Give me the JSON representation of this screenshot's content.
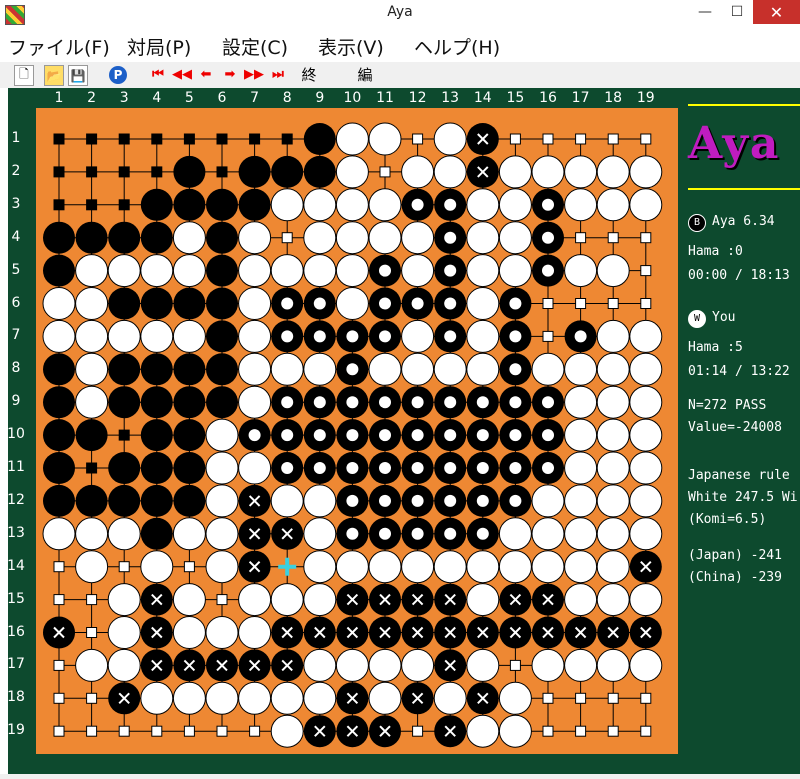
{
  "window": {
    "title": "Aya"
  },
  "window_controls": {
    "minimize": "—",
    "maximize": "☐",
    "close": "✕"
  },
  "menu": [
    "ファイル(F)",
    "対局(P)",
    "設定(C)",
    "表示(V)",
    "ヘルプ(H)"
  ],
  "toolbar": {
    "end_label": "終",
    "edit_label": "編",
    "pass_label": "P"
  },
  "board": {
    "size": 19,
    "col_labels": [
      "1",
      "2",
      "3",
      "4",
      "5",
      "6",
      "7",
      "8",
      "9",
      "10",
      "11",
      "12",
      "13",
      "14",
      "15",
      "16",
      "17",
      "18",
      "19"
    ],
    "row_labels": [
      "1",
      "2",
      "3",
      "4",
      "5",
      "6",
      "7",
      "8",
      "9",
      "10",
      "11",
      "12",
      "13",
      "14",
      "15",
      "16",
      "17",
      "18",
      "19"
    ],
    "grid": [
      "ssssssssBWWwWXwwwww",
      "ssssBsBBBWwWWXWWWWW",
      "sssBBBBWWWWRRWWRWWW",
      "BBBBWBWwWWWWRWWRwww",
      "BWWWWBWWWWRWRWWRWWw",
      "WWBBBBWRRWRRRWRwwww",
      "WWWWWBWRRRRWRWRwRWW",
      "BWBBBBWWWRWWWWRWWWW",
      "BWBBBBWRRRRRRRRRWWW",
      "BBsBBWRRRRRRRRRRWWW",
      "BsBBBWWRRRRRRRRRWWW",
      "BBBBBWXWWRRRRRRWWWW",
      "WWWBWWXXWRRRRRWWWWW",
      "sWsWwWXCWWWWWWWWWWX",
      "swWXWwWWWXXXXWXXWWW",
      "XwWXWWWXXXXXXXXXXXX",
      "sWWXXXXXWWWWXWwWWWW",
      "swXWWWWWWXWXWXWwwww",
      "sssssswWXXXsXWWssss"
    ]
  },
  "black_player": {
    "badge": "B",
    "name": "Aya 6.34",
    "hama": "Hama :0",
    "time": "00:00 / 18:13"
  },
  "white_player": {
    "badge": "W",
    "name": "You",
    "hama": "Hama :5",
    "time": "01:14 / 13:22"
  },
  "status": {
    "moves": "N=272   PASS",
    "value": "Value=-24008"
  },
  "result": {
    "rule": "Japanese rule",
    "winner": "White 247.5 Wi",
    "komi": "(Komi=6.5)",
    "japan": "(Japan) -241",
    "china": "(China) -239"
  },
  "logo": "Aya"
}
